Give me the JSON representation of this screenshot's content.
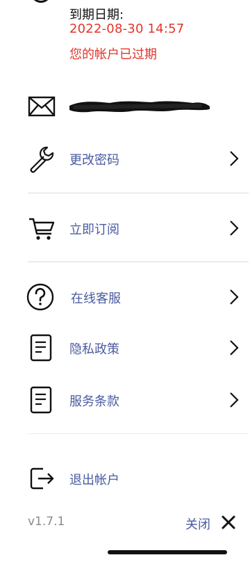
{
  "account": {
    "expiry_label": "到期日期:",
    "expiry_date": "2022-08-30 14:57",
    "expiry_status": "您的帐户已过期"
  },
  "menu": {
    "email_icon": "envelope-icon",
    "items": [
      {
        "label": "更改密码",
        "icon": "wrench-icon"
      },
      {
        "label": "立即订阅",
        "icon": "cart-icon"
      },
      {
        "label": "在线客服",
        "icon": "help-circle-icon"
      },
      {
        "label": "隐私政策",
        "icon": "document-icon"
      },
      {
        "label": "服务条款",
        "icon": "document-icon"
      }
    ],
    "logout": {
      "label": "退出帐户",
      "icon": "logout-icon"
    }
  },
  "footer": {
    "version": "v1.7.1",
    "close_label": "关闭"
  },
  "colors": {
    "accent": "#4a5ba0",
    "alert": "#e2352b",
    "divider": "#d9d9d9",
    "muted": "#8a8a8a"
  }
}
